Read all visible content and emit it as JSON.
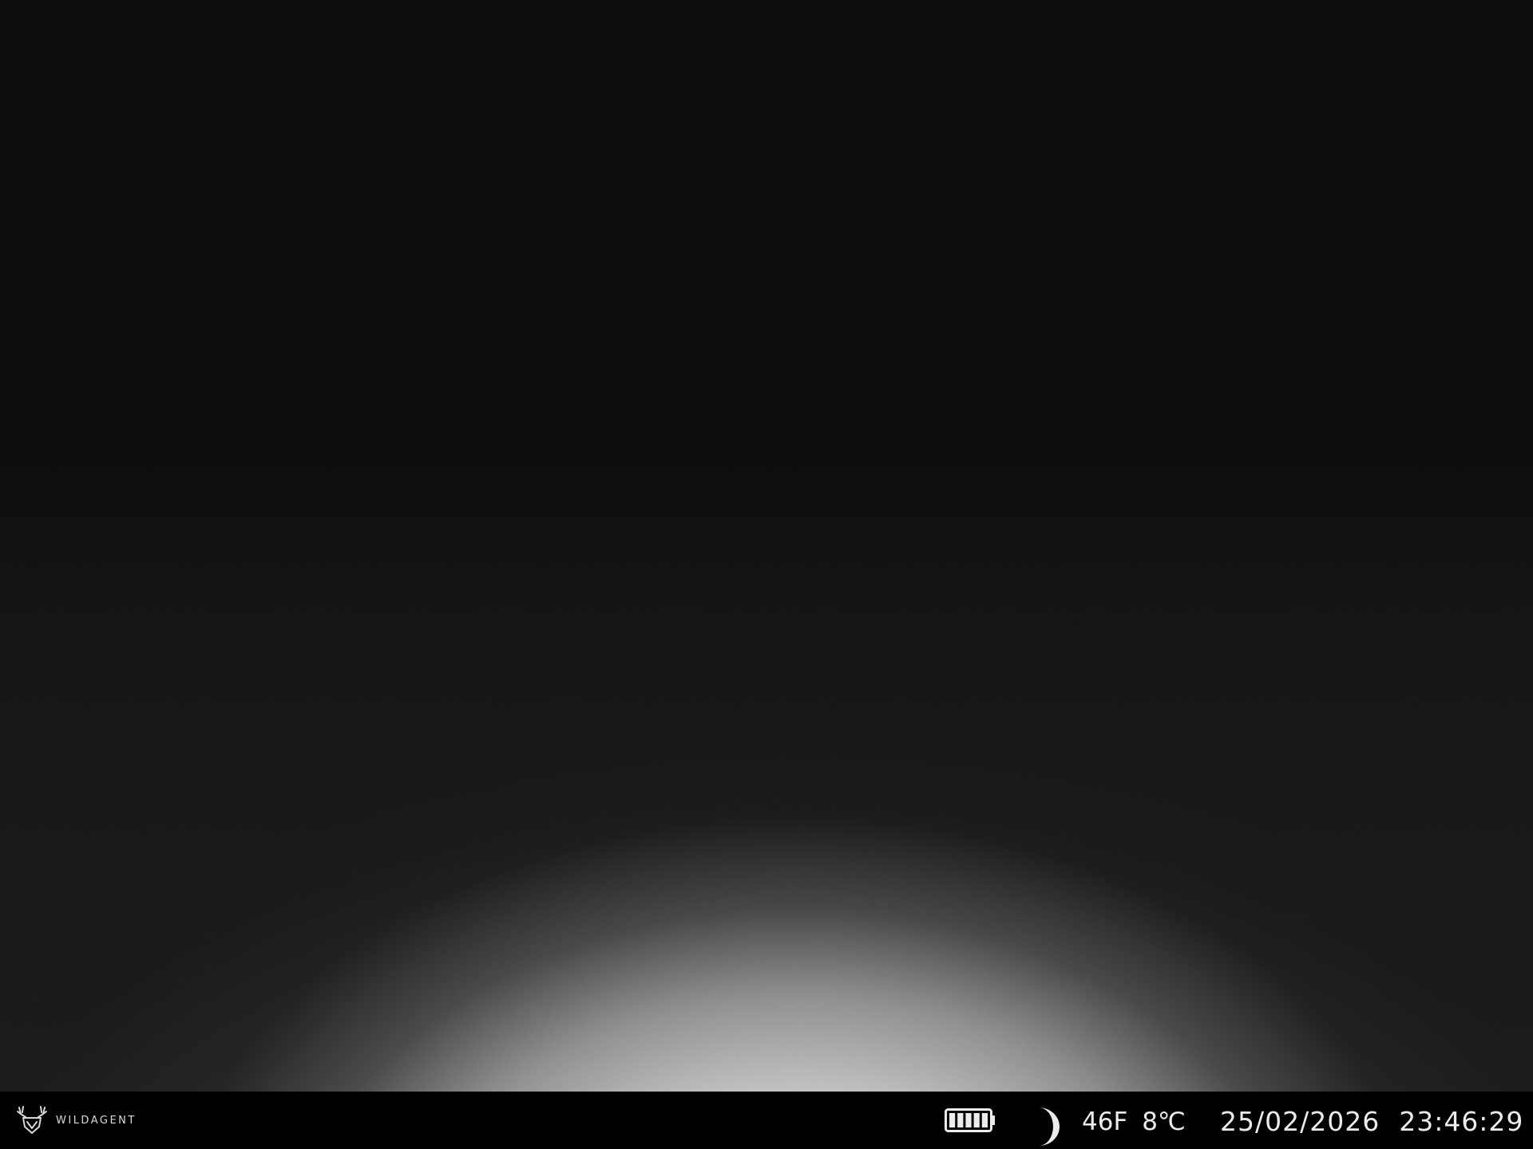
{
  "overlay": {
    "brand": {
      "logo_icon": "deer-antler-shield-icon",
      "name": "WILDAGENT"
    },
    "battery": {
      "icon": "battery-icon",
      "level": 1.0,
      "bars_total": 5,
      "bars_filled": 5
    },
    "moon_phase": {
      "icon": "moon-phase-icon",
      "phase": "waxing"
    },
    "temperature_f": "46F",
    "temperature_c": "8℃",
    "date": "25/02/2026",
    "time": "23:46:29"
  },
  "colors": {
    "bar_background": "#000000",
    "overlay_text": "#ececec"
  }
}
